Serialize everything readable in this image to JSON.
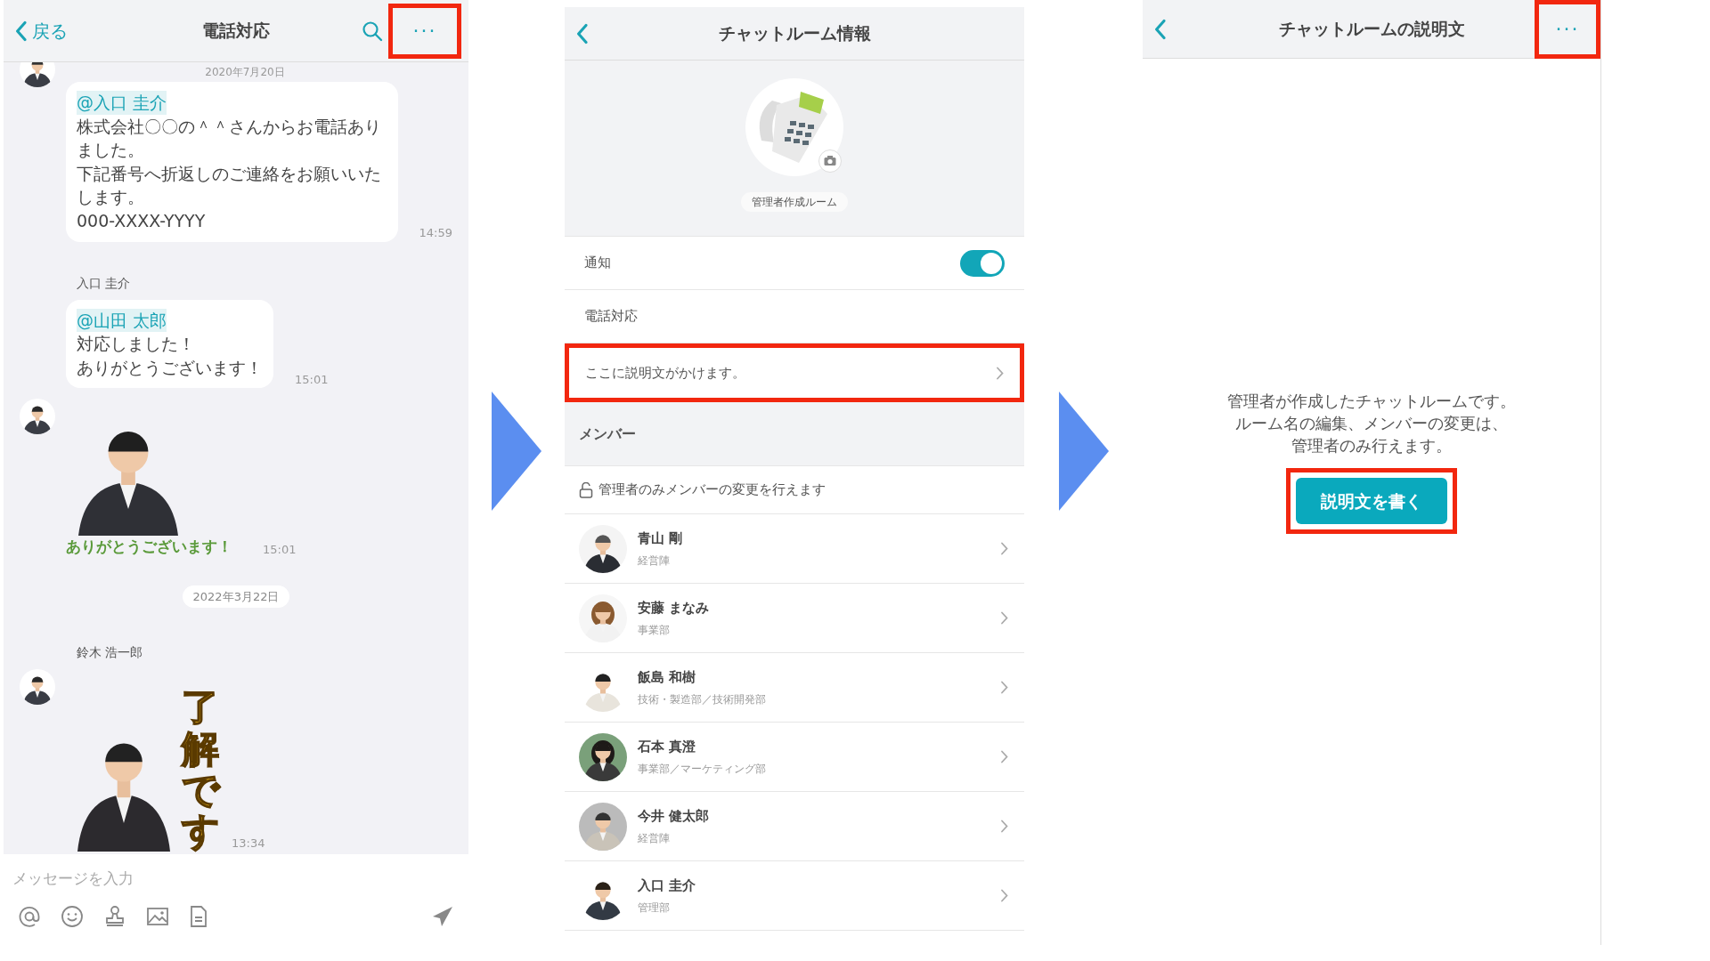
{
  "chat": {
    "back_label": "戻る",
    "title": "電話対応",
    "menu_label": "···",
    "menu_highlighted": true,
    "floating_date": "2020年7月20日",
    "items": [
      {
        "kind": "text",
        "avatar": true,
        "mention": "@入口 圭介",
        "lines": [
          "株式会社〇〇の＾＾さんからお電話ありました。",
          "下記番号へ折返しのご連絡をお願いいたします。",
          "000-XXXX-YYYY"
        ],
        "time": "14:59"
      },
      {
        "kind": "text",
        "sender": "入口 圭介",
        "avatar": false,
        "mention": "@山田 太郎",
        "lines": [
          "対応しました！",
          "ありがとうございます！"
        ],
        "time": "15:01"
      },
      {
        "kind": "sticker",
        "avatar": true,
        "caption": "ありがとうございます！",
        "vertical": false,
        "time": "15:01"
      },
      {
        "kind": "date",
        "label": "2022年3月22日"
      },
      {
        "kind": "sticker",
        "sender": "鈴木 浩一郎",
        "avatar": true,
        "caption": "了解です",
        "vertical": true,
        "time": "13:34"
      }
    ],
    "input": {
      "placeholder": "メッセージを入力"
    }
  },
  "info": {
    "title": "チャットルーム情報",
    "room_tag": "管理者作成ルーム",
    "notify": {
      "label": "通知",
      "on": true
    },
    "room_name": "電話対応",
    "description": {
      "text": "ここに説明文がかけます。",
      "highlighted": true
    },
    "members_heading": "メンバー",
    "lock_note": "管理者のみメンバーの変更を行えます",
    "members": [
      {
        "name": "青山 剛",
        "dept": "経営陣"
      },
      {
        "name": "安藤 まなみ",
        "dept": "事業部"
      },
      {
        "name": "飯島 和樹",
        "dept": "技術・製造部／技術開発部"
      },
      {
        "name": "石本 真澄",
        "dept": "事業部／マーケティング部"
      },
      {
        "name": "今井 健太郎",
        "dept": "経営陣"
      },
      {
        "name": "入口 圭介",
        "dept": "管理部"
      }
    ]
  },
  "description_page": {
    "title": "チャットルームの説明文",
    "menu_label": "···",
    "menu_highlighted": true,
    "lines": [
      "管理者が作成したチャットルームです。",
      "ルーム名の編集、メンバーの変更は、",
      "管理者のみ行えます。"
    ],
    "button": {
      "label": "説明文を書く",
      "highlighted": true
    }
  }
}
